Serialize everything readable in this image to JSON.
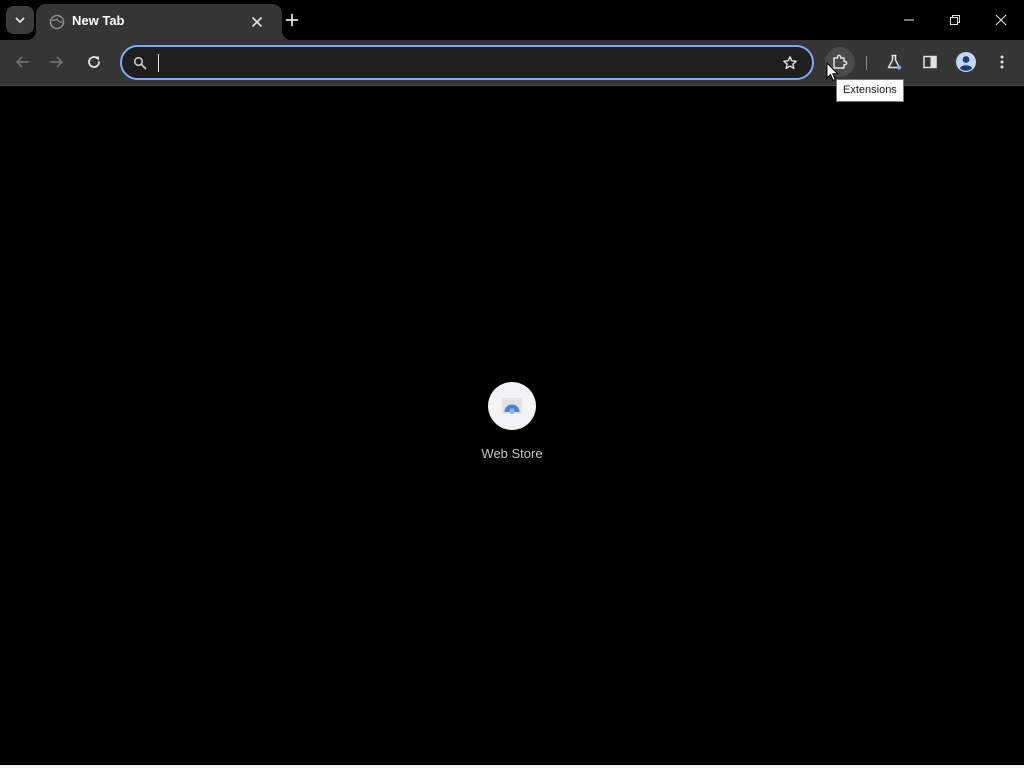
{
  "tabs": [
    {
      "title": "New Tab",
      "active": true
    }
  ],
  "tab_strip": {
    "tab_search_icon": "chevron-down-icon",
    "new_tab_icon": "plus-icon"
  },
  "window_controls": [
    "minimize-icon",
    "restore-icon",
    "close-icon"
  ],
  "toolbar": {
    "back_icon": "arrow-left-icon",
    "forward_icon": "arrow-right-icon",
    "reload_icon": "reload-icon",
    "omnibox": {
      "value": "",
      "placeholder": "",
      "search_icon": "search-icon",
      "bookmark_icon": "star-icon"
    },
    "extensions_icon": "puzzle-icon",
    "labs_icon": "flask-icon",
    "side_panel_icon": "side-panel-icon",
    "profile_icon": "avatar-icon",
    "menu_icon": "kebab-menu-icon"
  },
  "tooltip": {
    "text": "Extensions"
  },
  "ntp": {
    "shortcuts": [
      {
        "label": "Web Store",
        "icon": "web-store-icon"
      }
    ]
  },
  "colors": {
    "background": "#000000",
    "toolbar": "#353535",
    "omnibox_focus_ring": "#7cacf8",
    "accent": "#7cacf8"
  }
}
